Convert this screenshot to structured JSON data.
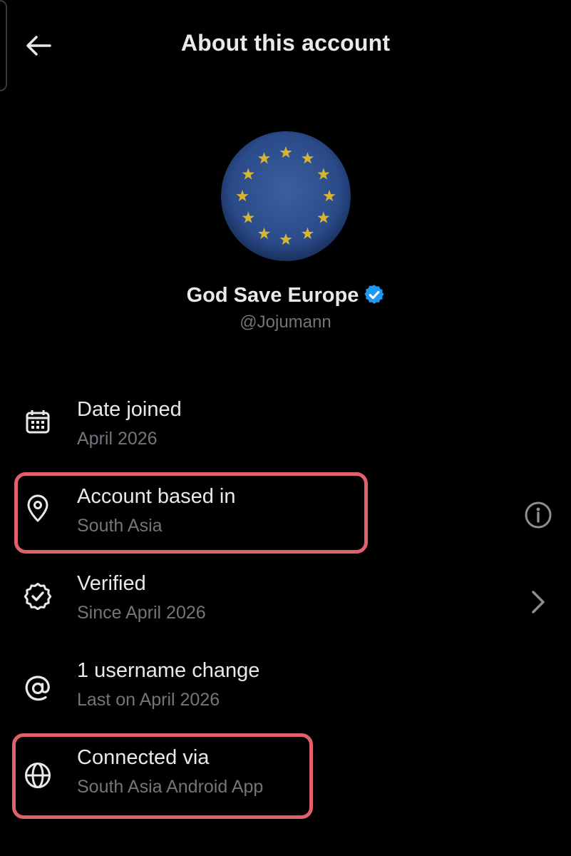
{
  "header": {
    "title": "About this account"
  },
  "profile": {
    "display_name": "God Save Europe",
    "handle": "@Jojumann",
    "verified": true
  },
  "rows": [
    {
      "label": "Date joined",
      "value": "April 2026",
      "icon": "calendar-icon"
    },
    {
      "label": "Account based in",
      "value": "South Asia",
      "icon": "location-pin-icon",
      "trailing": "info-icon"
    },
    {
      "label": "Verified",
      "value": "Since April 2026",
      "icon": "verified-badge-icon",
      "trailing": "chevron-right-icon"
    },
    {
      "label": "1 username change",
      "value": "Last on April 2026",
      "icon": "at-icon"
    },
    {
      "label": "Connected via",
      "value": "South Asia Android App",
      "icon": "globe-icon"
    }
  ],
  "colors": {
    "background": "#000000",
    "text_primary": "#e7e9ea",
    "text_secondary": "#71767b",
    "verified_blue": "#1d9bf0",
    "highlight": "#e0606b",
    "eu_blue": "#2a4a88",
    "eu_star": "#d8b530"
  }
}
